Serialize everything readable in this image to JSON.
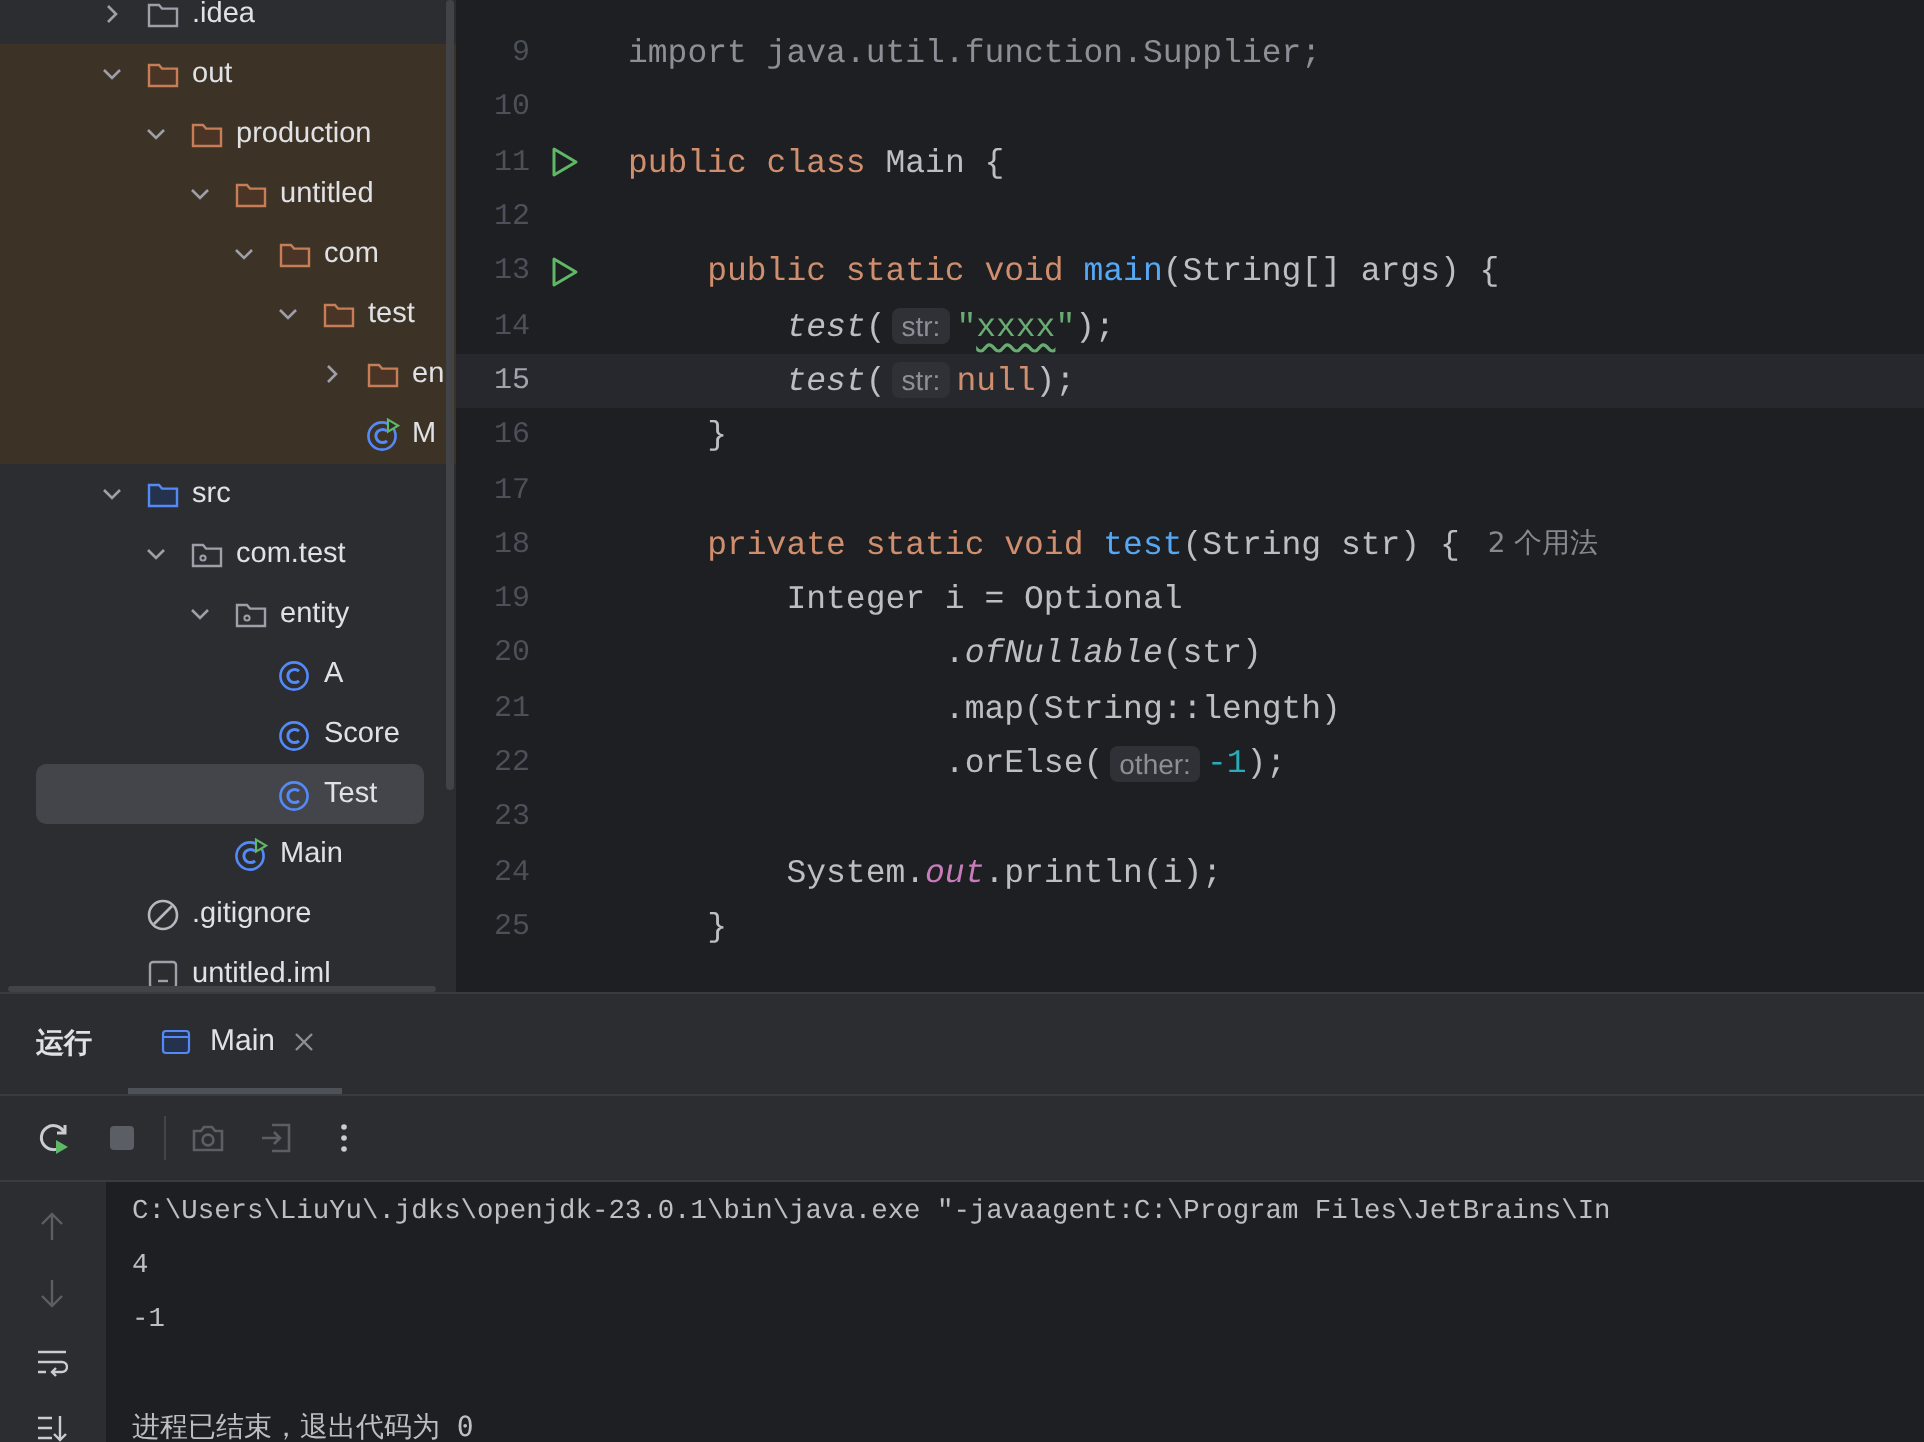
{
  "project_tree": [
    {
      "label": ".idea",
      "kind": "folder",
      "expanded": false,
      "excluded": false,
      "selected": false
    },
    {
      "label": "out",
      "kind": "folder",
      "expanded": true,
      "excluded": true,
      "selected": false,
      "children": [
        {
          "label": "production",
          "kind": "folder",
          "expanded": true,
          "selected": false,
          "children": [
            {
              "label": "untitled",
              "kind": "folder",
              "expanded": true,
              "selected": false,
              "children": [
                {
                  "label": "com",
                  "kind": "folder",
                  "expanded": true,
                  "selected": false,
                  "children": [
                    {
                      "label": "test",
                      "kind": "folder",
                      "expanded": true,
                      "selected": false,
                      "children": [
                        {
                          "label": "en",
                          "kind": "folder",
                          "expanded": false,
                          "selected": false
                        },
                        {
                          "label": "M",
                          "kind": "main-class",
                          "selected": false
                        }
                      ]
                    }
                  ]
                }
              ]
            }
          ]
        }
      ]
    },
    {
      "label": "src",
      "kind": "source-root",
      "expanded": true,
      "excluded": false,
      "selected": false,
      "children": [
        {
          "label": "com.test",
          "kind": "package",
          "expanded": true,
          "selected": false,
          "children": [
            {
              "label": "entity",
              "kind": "package",
              "expanded": true,
              "selected": false,
              "children": [
                {
                  "label": "A",
                  "kind": "class",
                  "selected": false
                },
                {
                  "label": "Score",
                  "kind": "class",
                  "selected": false
                },
                {
                  "label": "Test",
                  "kind": "class",
                  "selected": true
                }
              ]
            },
            {
              "label": "Main",
              "kind": "main-class",
              "selected": false
            }
          ]
        }
      ]
    },
    {
      "label": ".gitignore",
      "kind": "ignore-file",
      "excluded": false,
      "selected": false
    },
    {
      "label": "untitled.iml",
      "kind": "module-file",
      "excluded": false,
      "selected": false
    }
  ],
  "editor": {
    "lines": [
      {
        "number": "9",
        "tokens": [
          {
            "kind": "comment",
            "text": "import java.util.function.Supplier;"
          }
        ]
      },
      {
        "number": "10"
      },
      {
        "number": "11",
        "run": true,
        "tokens": [
          {
            "kind": "kw",
            "text": "public class "
          },
          {
            "kind": "plain",
            "text": "Main {"
          }
        ]
      },
      {
        "number": "12"
      },
      {
        "number": "13",
        "run": true,
        "tokens": [
          {
            "kind": "kw",
            "text": "    public static void "
          },
          {
            "kind": "fn",
            "text": "main"
          },
          {
            "kind": "plain",
            "text": "(String[] args) {"
          }
        ]
      },
      {
        "number": "14",
        "tokens": [
          {
            "kind": "static",
            "text": "        test"
          },
          {
            "kind": "plain",
            "text": "("
          },
          {
            "kind": "hint",
            "text": "str:"
          },
          {
            "kind": "str",
            "text": "\""
          },
          {
            "kind": "typo",
            "text": "xxxx"
          },
          {
            "kind": "str",
            "text": "\""
          },
          {
            "kind": "plain",
            "text": ");"
          }
        ]
      },
      {
        "number": "15",
        "current": true,
        "tokens": [
          {
            "kind": "static",
            "text": "        test"
          },
          {
            "kind": "plain",
            "text": "("
          },
          {
            "kind": "hint",
            "text": "str:"
          },
          {
            "kind": "kwv",
            "text": "null"
          },
          {
            "kind": "plain",
            "text": ");"
          }
        ]
      },
      {
        "number": "16",
        "tokens": [
          {
            "kind": "plain",
            "text": "    }"
          }
        ]
      },
      {
        "number": "17"
      },
      {
        "number": "18",
        "tokens": [
          {
            "kind": "kw",
            "text": "    private static void "
          },
          {
            "kind": "fn",
            "text": "test"
          },
          {
            "kind": "plain",
            "text": "(String str) {"
          },
          {
            "kind": "usage",
            "text": "2 个用法"
          }
        ]
      },
      {
        "number": "19",
        "tokens": [
          {
            "kind": "plain",
            "text": "        Integer i = Optional"
          }
        ]
      },
      {
        "number": "20",
        "tokens": [
          {
            "kind": "plain",
            "text": "                ."
          },
          {
            "kind": "static",
            "text": "ofNullable"
          },
          {
            "kind": "plain",
            "text": "(str)"
          }
        ]
      },
      {
        "number": "21",
        "tokens": [
          {
            "kind": "plain",
            "text": "                .map(String::length)"
          }
        ]
      },
      {
        "number": "22",
        "tokens": [
          {
            "kind": "plain",
            "text": "                .orElse("
          },
          {
            "kind": "hint",
            "text": "other:"
          },
          {
            "kind": "num",
            "text": "-1"
          },
          {
            "kind": "plain",
            "text": ");"
          }
        ]
      },
      {
        "number": "23"
      },
      {
        "number": "24",
        "tokens": [
          {
            "kind": "plain",
            "text": "        System."
          },
          {
            "kind": "field",
            "text": "out"
          },
          {
            "kind": "plain",
            "text": ".println(i);"
          }
        ]
      },
      {
        "number": "25",
        "tokens": [
          {
            "kind": "plain",
            "text": "    }"
          }
        ]
      }
    ]
  },
  "run_panel": {
    "title": "运行",
    "tabs": [
      {
        "label": "Main",
        "selected": true
      }
    ],
    "toolbar": [
      {
        "kind": "rerun",
        "disabled": false
      },
      {
        "kind": "stop",
        "disabled": true
      },
      {
        "kind": "camera",
        "disabled": true
      },
      {
        "kind": "restore",
        "disabled": true
      },
      {
        "kind": "more",
        "disabled": false
      }
    ],
    "side_tools": [
      {
        "kind": "up",
        "disabled": true
      },
      {
        "kind": "down",
        "disabled": true
      },
      {
        "kind": "wrap",
        "disabled": false
      },
      {
        "kind": "scroll-end",
        "disabled": false
      }
    ],
    "output": [
      {
        "text": "C:\\Users\\LiuYu\\.jdks\\openjdk-23.0.1\\bin\\java.exe \"-javaagent:C:\\Program Files\\JetBrains\\In",
        "gap_before": false
      },
      {
        "text": "4",
        "gap_before": false
      },
      {
        "text": "-1",
        "gap_before": false
      },
      {
        "text": "进程已结束，退出代码为 0",
        "gap_before": true
      }
    ]
  }
}
